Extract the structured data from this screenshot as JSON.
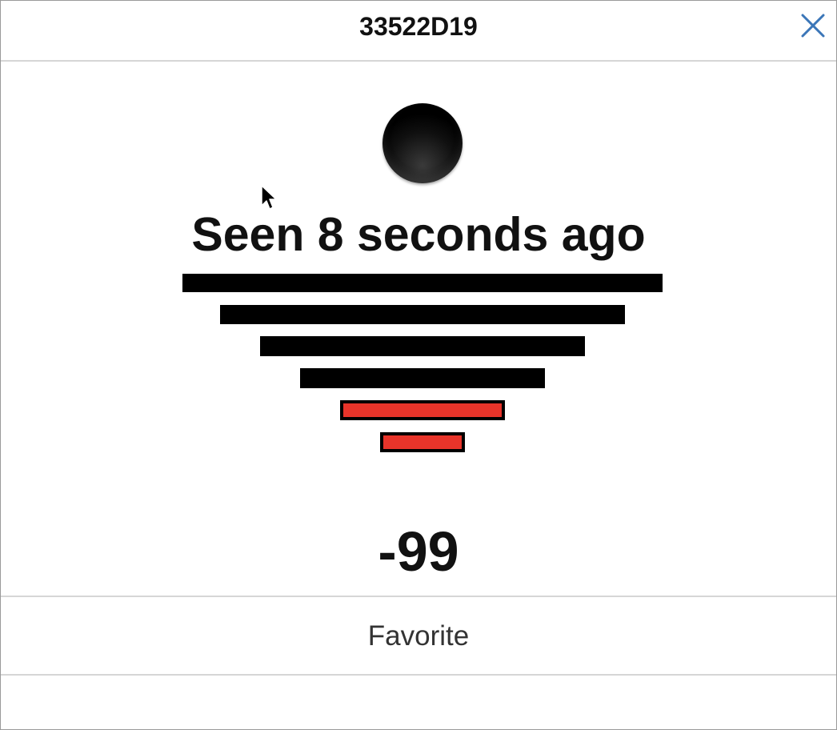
{
  "header": {
    "title": "33522D19"
  },
  "icons": {
    "close": "close-icon",
    "status": "status-dot-icon",
    "cursor": "mouse-pointer-icon"
  },
  "colors": {
    "close_icon": "#3b76b8",
    "bar_inactive": "#000000",
    "bar_active": "#e8342a",
    "status_dot": "#000000"
  },
  "status": {
    "seen_text": "Seen 8 seconds ago"
  },
  "signal": {
    "total_bars": 6,
    "active_bars": 2,
    "rssi_value": "-99"
  },
  "actions": {
    "favorite_label": "Favorite"
  }
}
